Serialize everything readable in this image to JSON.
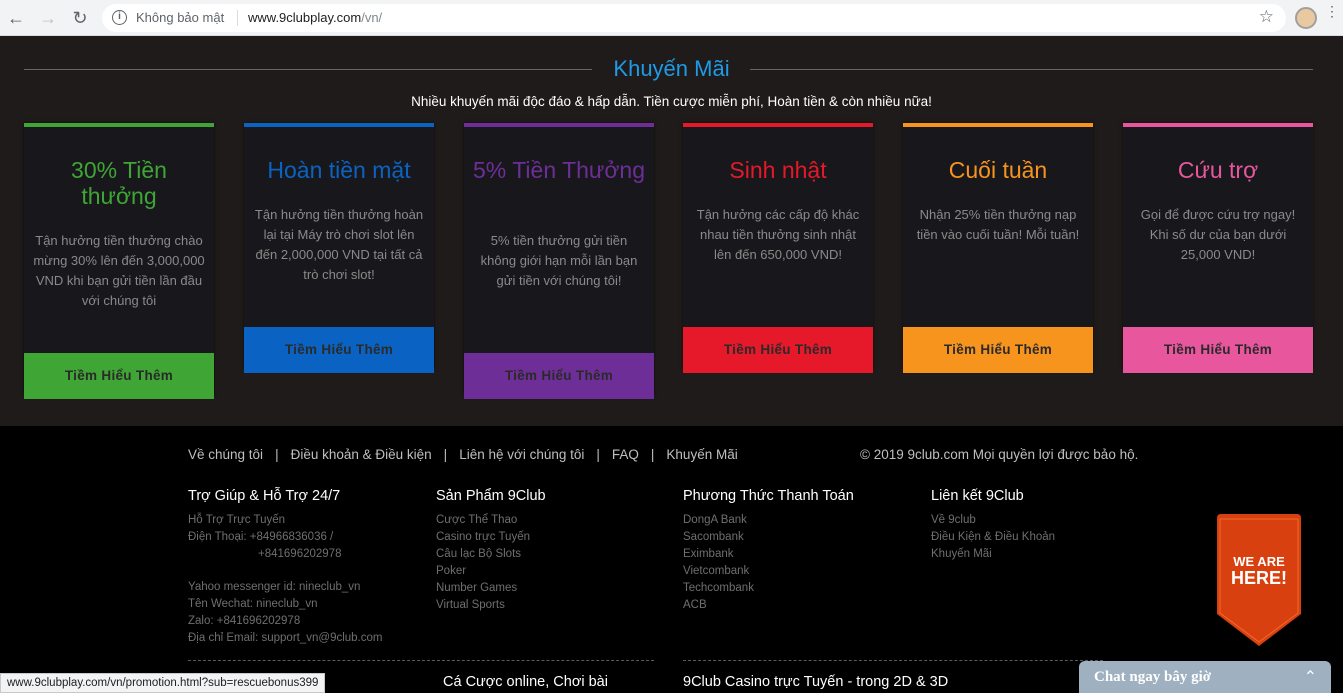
{
  "browser": {
    "security_label": "Không bảo mật",
    "url_host": "www.9clubplay.com",
    "url_path": "/vn/",
    "status_url": "www.9clubplay.com/vn/promotion.html?sub=rescuebonus399"
  },
  "promo": {
    "title": "Khuyến Mãi",
    "subtitle": "Nhiều khuyến mãi độc đáo & hấp dẫn. Tiền cược miễn phí, Hoàn tiền & còn nhiều nữa!",
    "cards": [
      {
        "title": "30% Tiền thưởng",
        "desc": "Tận hưởng tiền thưởng chào mừng 30% lên đến 3,000,000 VND khi bạn gửi tiền lần đầu với chúng tôi",
        "button": "Tiềm Hiểu Thêm",
        "color": "#3fa535"
      },
      {
        "title": "Hoàn tiền mặt",
        "desc": "Tận hưởng tiền thưởng hoàn lại tại Máy trò chơi slot lên đến 2,000,000 VND tại tất cả trò chơi slot!",
        "button": "Tiềm Hiểu Thêm",
        "color": "#0a63c2"
      },
      {
        "title": "5% Tiền Thưởng",
        "desc": "5% tiền thưởng gửi tiền không giới hạn mỗi lần bạn gửi tiền với chúng tôi!",
        "button": "Tiềm Hiểu Thêm",
        "color": "#6d2e98"
      },
      {
        "title": "Sinh nhật",
        "desc": "Tận hưởng các cấp độ khác nhau tiền thưởng sinh nhật lên đến 650,000 VND!",
        "button": "Tiềm Hiểu Thêm",
        "color": "#e5192a"
      },
      {
        "title": "Cuối tuần",
        "desc": "Nhận 25% tiền thưởng nạp tiền vào cuối tuần! Mỗi tuần!",
        "button": "Tiềm Hiểu Thêm",
        "color": "#f7941d"
      },
      {
        "title": "Cứu trợ",
        "desc": "Gọi để được cứu trợ ngay! Khi số dư của bạn dưới 25,000 VND!",
        "button": "Tiềm Hiểu Thêm",
        "color": "#e8569e"
      }
    ]
  },
  "footer": {
    "links": [
      "Về chúng tôi",
      "Điều khoản & Điều kiện",
      "Liên hệ với chúng tôi",
      "FAQ",
      "Khuyến Mãi"
    ],
    "copyright": "© 2019 9club.com Mọi quyền lợi được bảo hộ.",
    "support": {
      "title": "Trợ Giúp & Hỗ Trợ 24/7",
      "items": [
        "Hỗ Trợ Trực Tuyến",
        "Điện Thoại:  +84966836036 /",
        "+841696202978",
        "Yahoo messenger id: nineclub_vn",
        "Tên Wechat: nineclub_vn",
        "Zalo: +841696202978",
        "Địa chỉ Email: support_vn@9club.com"
      ]
    },
    "products": {
      "title": "Sản Phẩm 9Club",
      "items": [
        "Cược Thể Thao",
        "Casino trực Tuyến",
        "Câu lạc Bộ Slots",
        "Poker",
        "Number Games",
        "Virtual Sports"
      ]
    },
    "payments": {
      "title": "Phương Thức Thanh Toán",
      "items": [
        "DongA Bank",
        "Sacombank",
        "Eximbank",
        "Vietcombank",
        "Techcombank",
        "ACB"
      ]
    },
    "affiliates": {
      "title": "Liên kết 9Club",
      "items": [
        "Về 9club",
        "Điều Kiện & Điều Khoản",
        "Khuyến Mãi"
      ]
    },
    "bottom_title_left": "Cá Cược online, Chơi bài",
    "bottom_title_right": "9Club Casino trực Tuyến - trong 2D & 3D"
  },
  "badge": {
    "line1": "WE ARE",
    "line2": "HERE!"
  },
  "chat": {
    "label": "Chat ngay bây giờ"
  }
}
